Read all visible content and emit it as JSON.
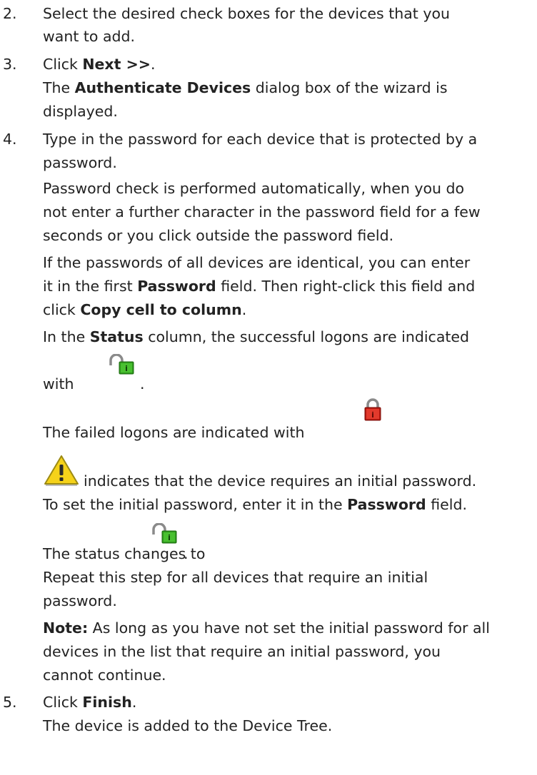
{
  "steps": [
    {
      "number": "2.",
      "lines": [
        {
          "text": "Select the desired check boxes for the devices that you"
        },
        {
          "text": "want to add."
        }
      ]
    },
    {
      "number": "3.",
      "lines": [
        {
          "pre": "Click ",
          "bold": "Next >>",
          "post": "."
        },
        {
          "pre": "The ",
          "bold": "Authenticate Devices",
          "post": " dialog box of the wizard is"
        },
        {
          "text": "displayed."
        }
      ]
    },
    {
      "number": "4.",
      "lines": [
        {
          "text": "Type in the password for each device that is protected by a"
        },
        {
          "text": "password."
        },
        {
          "text": "Password check is performed automatically, when you do"
        },
        {
          "text": "not enter a further character in the password field for a few"
        },
        {
          "text": "seconds or you click outside the password field."
        },
        {
          "text": "If the passwords of all devices are identical, you can enter"
        },
        {
          "pre": "it in the first ",
          "bold": "Password",
          "post": " field. Then right-click this field and"
        },
        {
          "pre": "click ",
          "bold": "Copy cell to column",
          "post": "."
        },
        {
          "pre": "In the ",
          "bold": "Status",
          "post": " column, the successful logons are indicated"
        },
        {
          "text": "with"
        },
        {
          "text": "."
        },
        {
          "text": "The failed logons are indicated with"
        },
        {
          "text": "indicates that the device requires an initial password."
        },
        {
          "pre": "To set the initial password, enter it in the ",
          "bold": "Password",
          "post": " field."
        },
        {
          "text": "The status changes to"
        },
        {
          "text": "."
        },
        {
          "text": "Repeat this step for all devices that require an initial"
        },
        {
          "text": "password."
        },
        {
          "pre": "",
          "bold": "Note:",
          "post": " As long as you have not set the initial password for all"
        },
        {
          "text": "devices in the list that require an initial password, you"
        },
        {
          "text": "cannot continue."
        }
      ]
    },
    {
      "number": "5.",
      "lines": [
        {
          "pre": "Click ",
          "bold": "Finish",
          "post": "."
        },
        {
          "text": "The device is added to the Device Tree."
        }
      ]
    }
  ],
  "icons": {
    "success": "unlocked-padlock-icon",
    "failure": "locked-padlock-icon",
    "warning": "warning-triangle-icon"
  },
  "colors": {
    "text": "#222222",
    "success_green": "#2e9a1c",
    "failure_red": "#d8261c",
    "warning_yellow": "#f5d21a"
  }
}
